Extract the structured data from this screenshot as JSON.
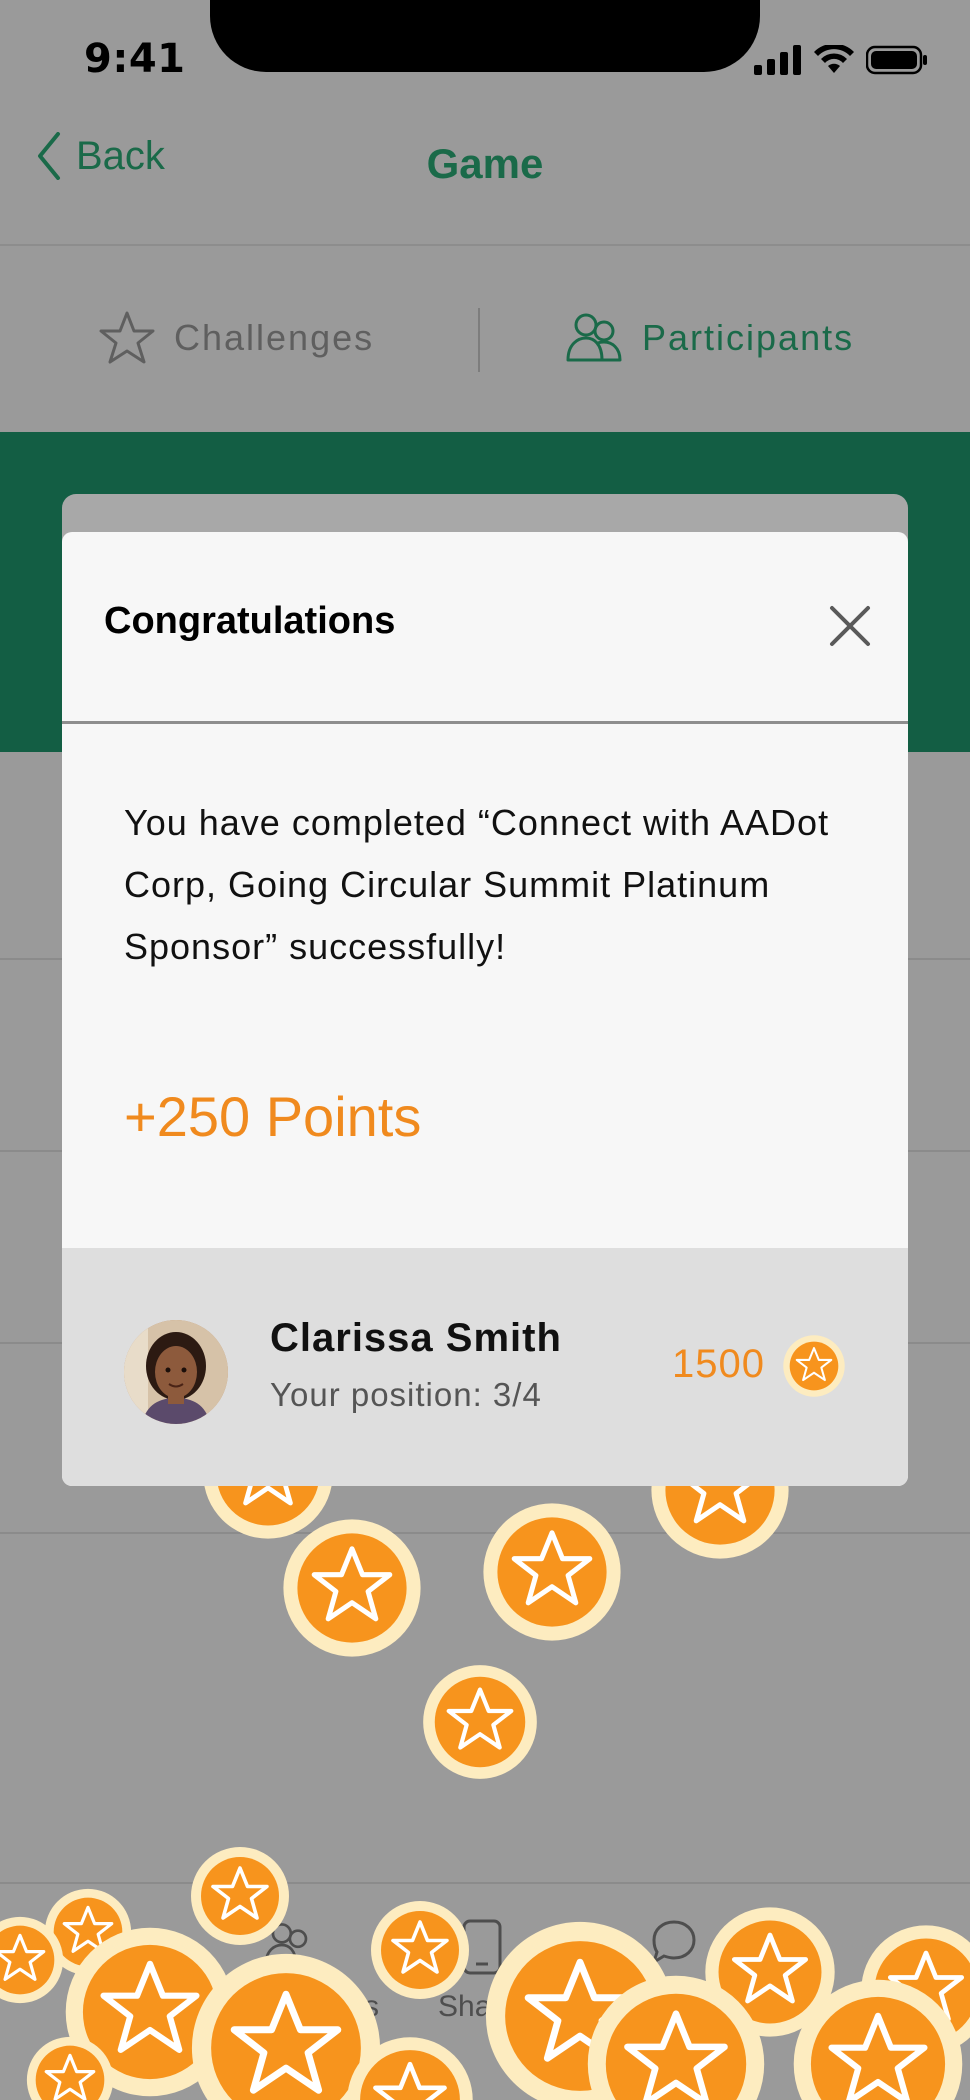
{
  "status": {
    "time": "9:41"
  },
  "nav": {
    "back_label": "Back",
    "title": "Game"
  },
  "segments": {
    "challenges": "Challenges",
    "participants": "Participants"
  },
  "tabbar": {
    "fragment_1": "s",
    "fragment_2": "Sha"
  },
  "modal": {
    "title": "Congratulations",
    "message": "You have completed “Connect with AADot Corp, Going Circular Summit Platinum Sponsor” successfully!",
    "points": "+250 Points"
  },
  "user": {
    "name": "Clarissa Smith",
    "position": "Your position: 3/4",
    "score": "1500"
  },
  "colors": {
    "brand_green": "#135e44",
    "accent_orange": "#f08a1e",
    "coin_fill": "#f7941d",
    "coin_ring": "#fdecc0"
  }
}
